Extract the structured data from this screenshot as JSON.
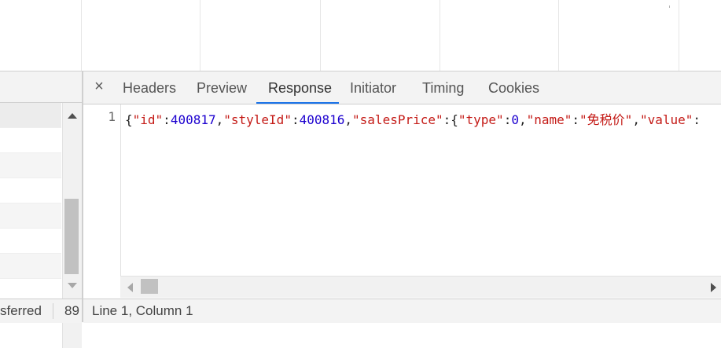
{
  "details": {
    "close_icon": "×",
    "tabs": [
      {
        "label": "Headers"
      },
      {
        "label": "Preview"
      },
      {
        "label": "Response",
        "active": true
      },
      {
        "label": "Initiator"
      },
      {
        "label": "Timing"
      },
      {
        "label": "Cookies"
      }
    ],
    "response": {
      "line_number": "1",
      "tokens": [
        {
          "t": "{",
          "c": "pun"
        },
        {
          "t": "\"id\"",
          "c": "key"
        },
        {
          "t": ":",
          "c": "pun"
        },
        {
          "t": "400817",
          "c": "num"
        },
        {
          "t": ",",
          "c": "pun"
        },
        {
          "t": "\"styleId\"",
          "c": "key"
        },
        {
          "t": ":",
          "c": "pun"
        },
        {
          "t": "400816",
          "c": "num"
        },
        {
          "t": ",",
          "c": "pun"
        },
        {
          "t": "\"salesPrice\"",
          "c": "key"
        },
        {
          "t": ":{",
          "c": "pun"
        },
        {
          "t": "\"type\"",
          "c": "key"
        },
        {
          "t": ":",
          "c": "pun"
        },
        {
          "t": "0",
          "c": "num"
        },
        {
          "t": ",",
          "c": "pun"
        },
        {
          "t": "\"name\"",
          "c": "key"
        },
        {
          "t": ":",
          "c": "pun"
        },
        {
          "t": "\"免税价\"",
          "c": "str"
        },
        {
          "t": ",",
          "c": "pun"
        },
        {
          "t": "\"value\"",
          "c": "key"
        },
        {
          "t": ":",
          "c": "pun"
        }
      ]
    },
    "status": "Line 1, Column 1"
  },
  "request_list": {
    "summary_text": "sferred",
    "summary_count": "89"
  },
  "colors": {
    "accent": "#1a73e8",
    "json_key": "#c41a16",
    "json_number": "#1c00cf"
  },
  "icons": {
    "close": "close-icon",
    "scroll_up": "chevron-up-icon",
    "scroll_down": "chevron-down-icon",
    "scroll_left": "chevron-left-icon",
    "scroll_right": "chevron-right-icon"
  }
}
